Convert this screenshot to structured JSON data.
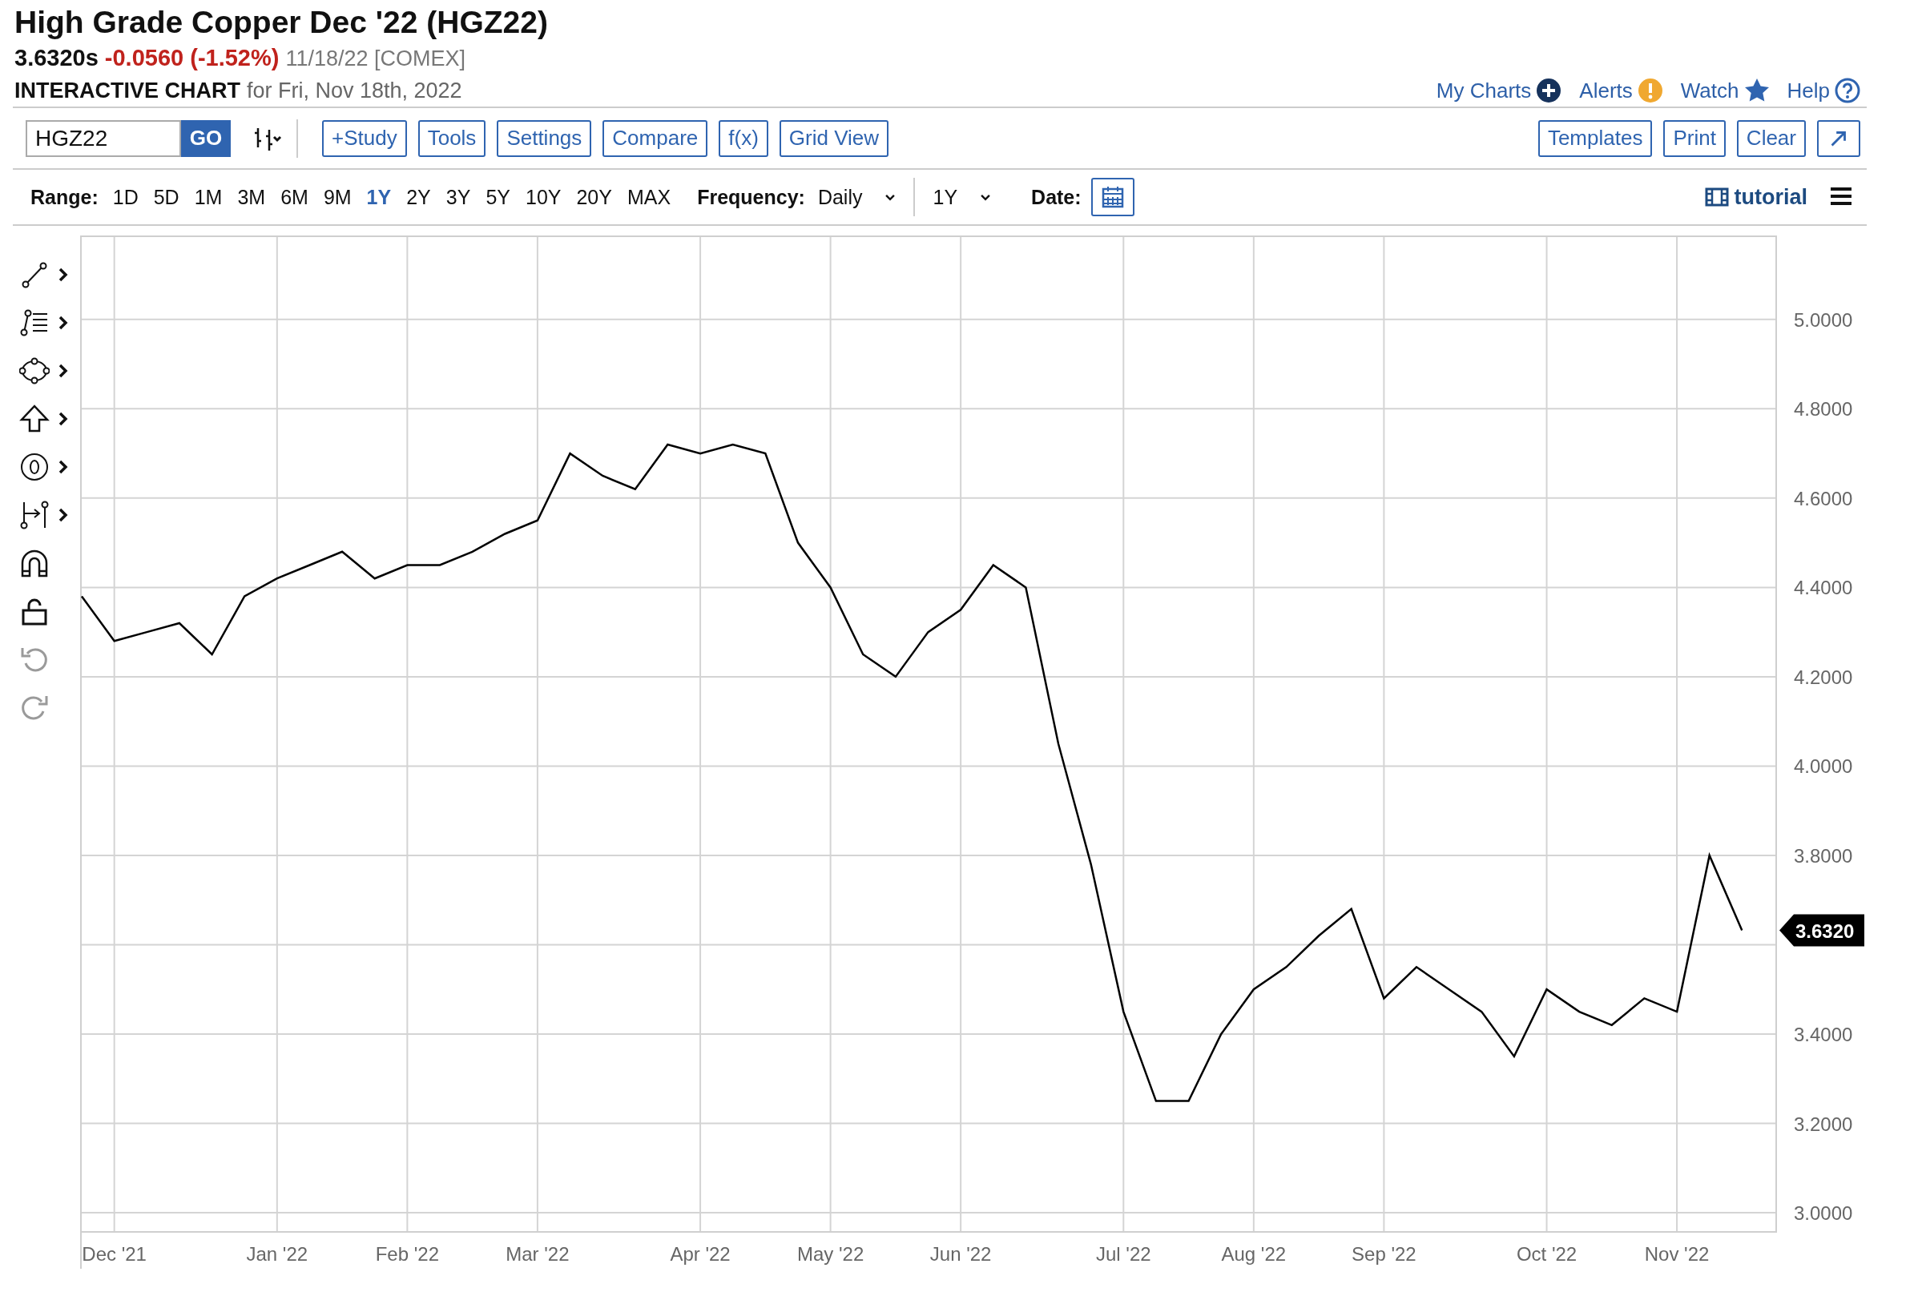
{
  "title": "High Grade Copper Dec '22 (HGZ22)",
  "quote": {
    "price": "3.6320s",
    "change": "-0.0560 (-1.52%)",
    "date": "11/18/22 [COMEX]"
  },
  "subtitle": {
    "label": "INTERACTIVE CHART",
    "date": "for Fri, Nov 18th, 2022"
  },
  "header_links": [
    {
      "label": "My Charts",
      "kind": "plus"
    },
    {
      "label": "Alerts",
      "kind": "alert"
    },
    {
      "label": "Watch",
      "kind": "star"
    },
    {
      "label": "Help",
      "kind": "help"
    }
  ],
  "toolbar": {
    "symbol": "HGZ22",
    "go": "GO",
    "buttons": [
      "+Study",
      "Tools",
      "Settings",
      "Compare",
      "f(x)",
      "Grid View"
    ],
    "right_buttons": [
      "Templates",
      "Print",
      "Clear"
    ]
  },
  "range": {
    "label": "Range:",
    "options": [
      {
        "label": "1D",
        "selected": false
      },
      {
        "label": "5D",
        "selected": false
      },
      {
        "label": "1M",
        "selected": false
      },
      {
        "label": "3M",
        "selected": false
      },
      {
        "label": "6M",
        "selected": false
      },
      {
        "label": "9M",
        "selected": false
      },
      {
        "label": "1Y",
        "selected": true
      },
      {
        "label": "2Y",
        "selected": false
      },
      {
        "label": "3Y",
        "selected": false
      },
      {
        "label": "5Y",
        "selected": false
      },
      {
        "label": "10Y",
        "selected": false
      },
      {
        "label": "20Y",
        "selected": false
      },
      {
        "label": "MAX",
        "selected": false
      }
    ]
  },
  "frequency": {
    "label": "Frequency:",
    "value": "Daily"
  },
  "period": {
    "value": "1Y"
  },
  "date": {
    "label": "Date:"
  },
  "tutorial": "tutorial",
  "left_toolbar": [
    {
      "kind": "line",
      "submenu": true,
      "disabled": false
    },
    {
      "kind": "fibonacci",
      "submenu": true,
      "disabled": false
    },
    {
      "kind": "shape",
      "submenu": true,
      "disabled": false
    },
    {
      "kind": "arrow",
      "submenu": true,
      "disabled": false
    },
    {
      "kind": "label",
      "submenu": true,
      "disabled": false
    },
    {
      "kind": "measure",
      "submenu": true,
      "disabled": false
    },
    {
      "kind": "magnet",
      "submenu": false,
      "disabled": false
    },
    {
      "kind": "lock",
      "submenu": false,
      "disabled": false
    },
    {
      "kind": "undo",
      "submenu": false,
      "disabled": true
    },
    {
      "kind": "redo",
      "submenu": false,
      "disabled": true
    }
  ],
  "chart": {
    "price_marker": "3.6320",
    "chart_data": {
      "type": "line",
      "categories": [
        null,
        "Dec '21",
        null,
        null,
        null,
        null,
        "Jan '22",
        null,
        null,
        null,
        "Feb '22",
        null,
        null,
        null,
        "Mar '22",
        null,
        null,
        null,
        null,
        "Apr '22",
        null,
        null,
        null,
        "May '22",
        null,
        null,
        null,
        "Jun '22",
        null,
        null,
        null,
        null,
        "Jul '22",
        null,
        null,
        null,
        "Aug '22",
        null,
        null,
        null,
        "Sep '22",
        null,
        null,
        null,
        null,
        "Oct '22",
        null,
        null,
        null,
        "Nov '22",
        null,
        null
      ],
      "values": [
        4.38,
        4.28,
        4.3,
        4.32,
        4.25,
        4.38,
        4.42,
        4.45,
        4.48,
        4.42,
        4.45,
        4.45,
        4.48,
        4.52,
        4.55,
        4.7,
        4.65,
        4.62,
        4.72,
        4.7,
        4.72,
        4.7,
        4.5,
        4.4,
        4.25,
        4.2,
        4.3,
        4.35,
        4.45,
        4.4,
        4.05,
        3.78,
        3.45,
        3.25,
        3.25,
        3.4,
        3.5,
        3.55,
        3.62,
        3.68,
        3.48,
        3.55,
        3.5,
        3.45,
        3.35,
        3.5,
        3.45,
        3.42,
        3.48,
        3.45,
        3.8,
        3.632
      ],
      "grid": true,
      "ylim": [
        2.957,
        5.188
      ],
      "yticks": [
        {
          "value": 3,
          "label": "3.0000"
        },
        {
          "value": 3.2,
          "label": "3.2000"
        },
        {
          "value": 3.4,
          "label": "3.4000"
        },
        {
          "value": 3.8,
          "label": "3.8000"
        },
        {
          "value": 4,
          "label": "4.0000"
        },
        {
          "value": 4.2,
          "label": "4.2000"
        },
        {
          "value": 4.4,
          "label": "4.4000"
        },
        {
          "value": 4.6,
          "label": "4.6000"
        },
        {
          "value": 4.8,
          "label": "4.8000"
        },
        {
          "value": 5,
          "label": "5.0000"
        }
      ]
    }
  }
}
